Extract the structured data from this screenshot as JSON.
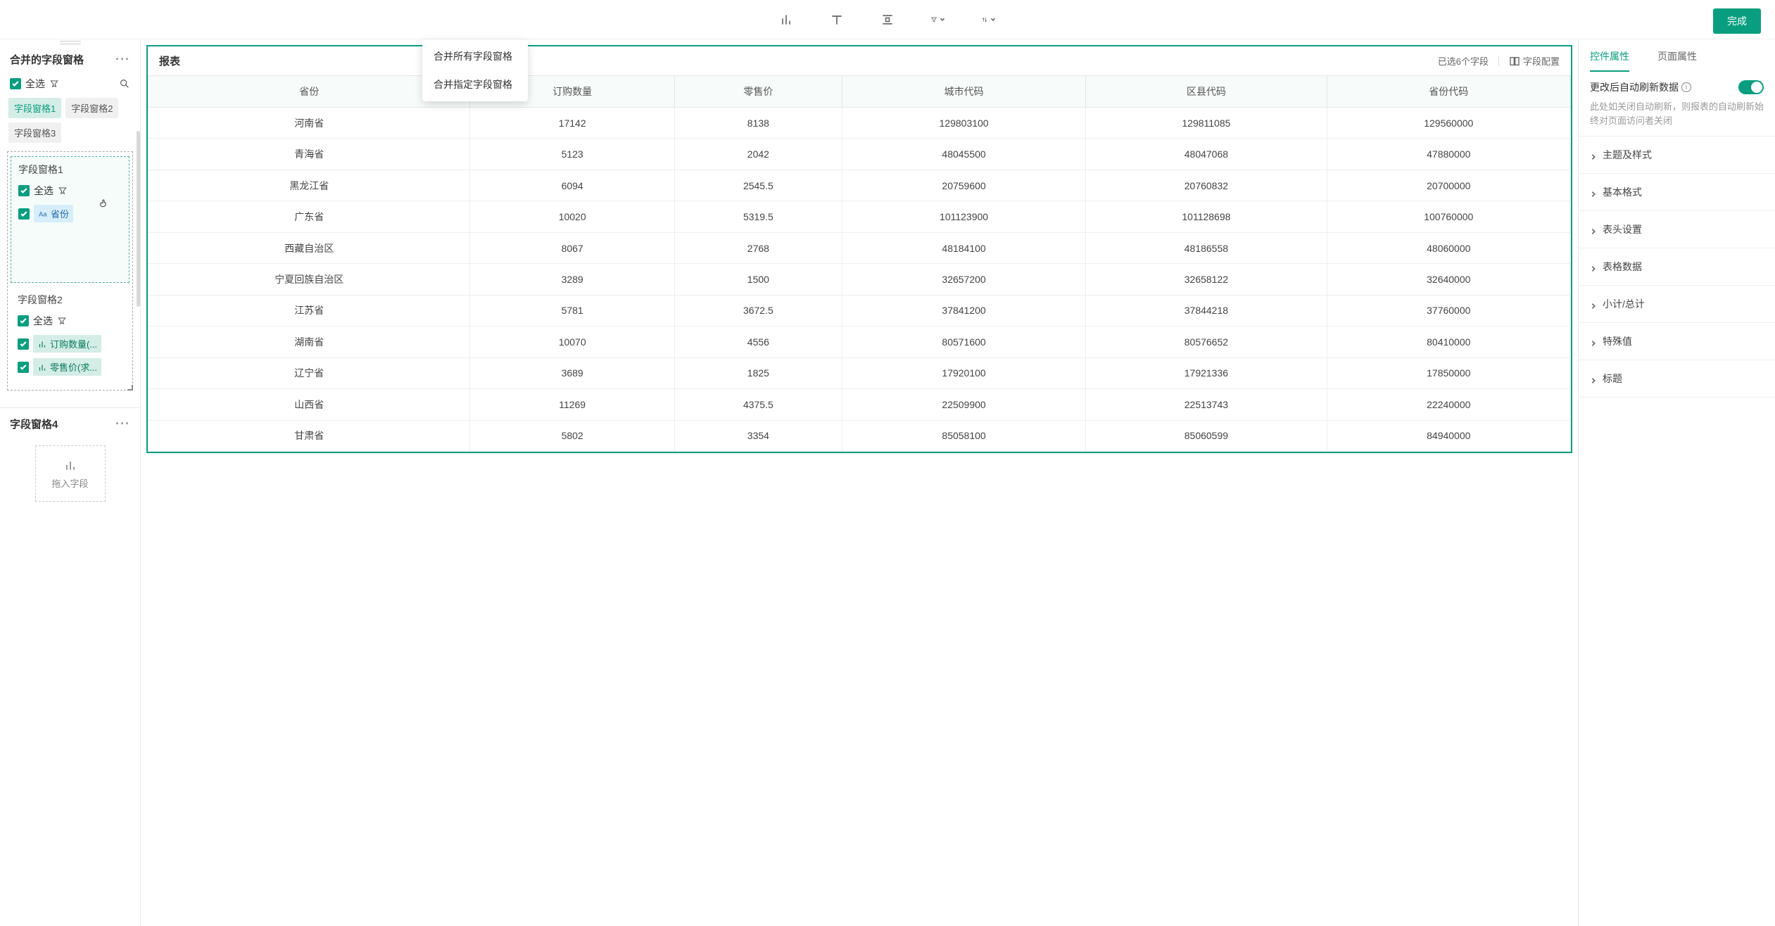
{
  "toolbar": {
    "done_label": "完成",
    "dropdown": {
      "merge_all": "合并所有字段窗格",
      "merge_specific": "合并指定字段窗格"
    }
  },
  "sidebar": {
    "merged_pane_title": "合并的字段窗格",
    "select_all": "全选",
    "pills": [
      "字段窗格1",
      "字段窗格2",
      "字段窗格3"
    ],
    "pane1": {
      "title": "字段窗格1",
      "select_all": "全选",
      "field_province": "省份"
    },
    "pane2": {
      "title": "字段窗格2",
      "select_all": "全选",
      "field_order_qty": "订购数量(...",
      "field_retail_price": "零售价(求..."
    },
    "pane4_title": "字段窗格4",
    "drop_hint": "拖入字段"
  },
  "report": {
    "title": "报表",
    "selected_count": "已选6个字段",
    "field_config": "字段配置",
    "columns": [
      "省份",
      "订购数量",
      "零售价",
      "城市代码",
      "区县代码",
      "省份代码"
    ],
    "rows": [
      [
        "河南省",
        "17142",
        "8138",
        "129803100",
        "129811085",
        "129560000"
      ],
      [
        "青海省",
        "5123",
        "2042",
        "48045500",
        "48047068",
        "47880000"
      ],
      [
        "黑龙江省",
        "6094",
        "2545.5",
        "20759600",
        "20760832",
        "20700000"
      ],
      [
        "广东省",
        "10020",
        "5319.5",
        "101123900",
        "101128698",
        "100760000"
      ],
      [
        "西藏自治区",
        "8067",
        "2768",
        "48184100",
        "48186558",
        "48060000"
      ],
      [
        "宁夏回族自治区",
        "3289",
        "1500",
        "32657200",
        "32658122",
        "32640000"
      ],
      [
        "江苏省",
        "5781",
        "3672.5",
        "37841200",
        "37844218",
        "37760000"
      ],
      [
        "湖南省",
        "10070",
        "4556",
        "80571600",
        "80576652",
        "80410000"
      ],
      [
        "辽宁省",
        "3689",
        "1825",
        "17920100",
        "17921336",
        "17850000"
      ],
      [
        "山西省",
        "11269",
        "4375.5",
        "22509900",
        "22513743",
        "22240000"
      ],
      [
        "甘肃省",
        "5802",
        "3354",
        "85058100",
        "85060599",
        "84940000"
      ]
    ]
  },
  "right": {
    "tabs": {
      "component": "控件属性",
      "page": "页面属性"
    },
    "auto_refresh": {
      "label": "更改后自动刷新数据",
      "desc": "此处如关闭自动刷新，则报表的自动刷新始终对页面访问者关闭"
    },
    "accordions": [
      "主题及样式",
      "基本格式",
      "表头设置",
      "表格数据",
      "小计/总计",
      "特殊值",
      "标题"
    ]
  }
}
